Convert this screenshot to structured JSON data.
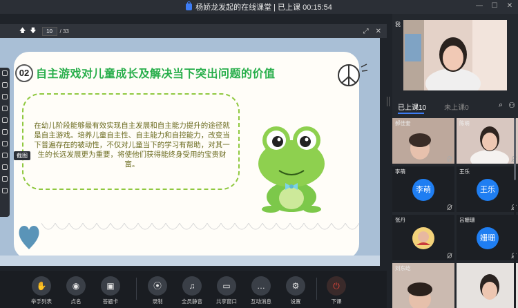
{
  "window": {
    "title": "杨娇龙发起的在线课堂 | 已上课 00:15:54",
    "controls": [
      "minimize",
      "maximize",
      "close"
    ]
  },
  "doc_toolbar": {
    "current_page": "10",
    "total_pages": "/ 33"
  },
  "slide": {
    "number": "02",
    "title": "自主游戏对儿童成长及解决当下突出问题的价值",
    "body": "在幼儿阶段能够最有效实现自主发展和自主能力提升的途径就是自主游戏。培养儿童自主性、自主能力和自控能力，改变当下普遍存在的被动性，不仅对儿童当下的学习有帮助，对其一生的长远发展更为重要，将使他们获得能终身受用的宝贵财富。",
    "colors": {
      "title": "#27ae4a",
      "border": "#8fc83f",
      "text": "#6b6b1f"
    }
  },
  "left_tools": {
    "tooltip": "截图"
  },
  "bottom_bar": {
    "controls": [
      {
        "label": "举手列表",
        "icon": "hand-icon"
      },
      {
        "label": "点名",
        "icon": "location-icon"
      },
      {
        "label": "答题卡",
        "icon": "card-icon"
      },
      {
        "label": "录制",
        "icon": "record-icon"
      },
      {
        "label": "全员静音",
        "icon": "mute-all-icon"
      },
      {
        "label": "共享窗口",
        "icon": "share-window-icon"
      },
      {
        "label": "互动消息",
        "icon": "chat-icon"
      },
      {
        "label": "设置",
        "icon": "gear-icon"
      },
      {
        "label": "下课",
        "icon": "power-icon"
      }
    ]
  },
  "right_panel": {
    "me_label": "我",
    "tabs": [
      {
        "label": "已上课10"
      },
      {
        "label": "未上课0"
      }
    ],
    "tiles": [
      {
        "name": "郝佳奎",
        "avatar": ""
      },
      {
        "name": "陈萌",
        "avatar": ""
      },
      {
        "name": "李萌",
        "avatar": "李萌"
      },
      {
        "name": "王乐",
        "avatar": "王乐"
      },
      {
        "name": "张丹",
        "avatar": ""
      },
      {
        "name": "吕姗珊",
        "avatar": "姗珊"
      },
      {
        "name": "刘东屹",
        "avatar": ""
      },
      {
        "name": "",
        "avatar": ""
      }
    ]
  }
}
